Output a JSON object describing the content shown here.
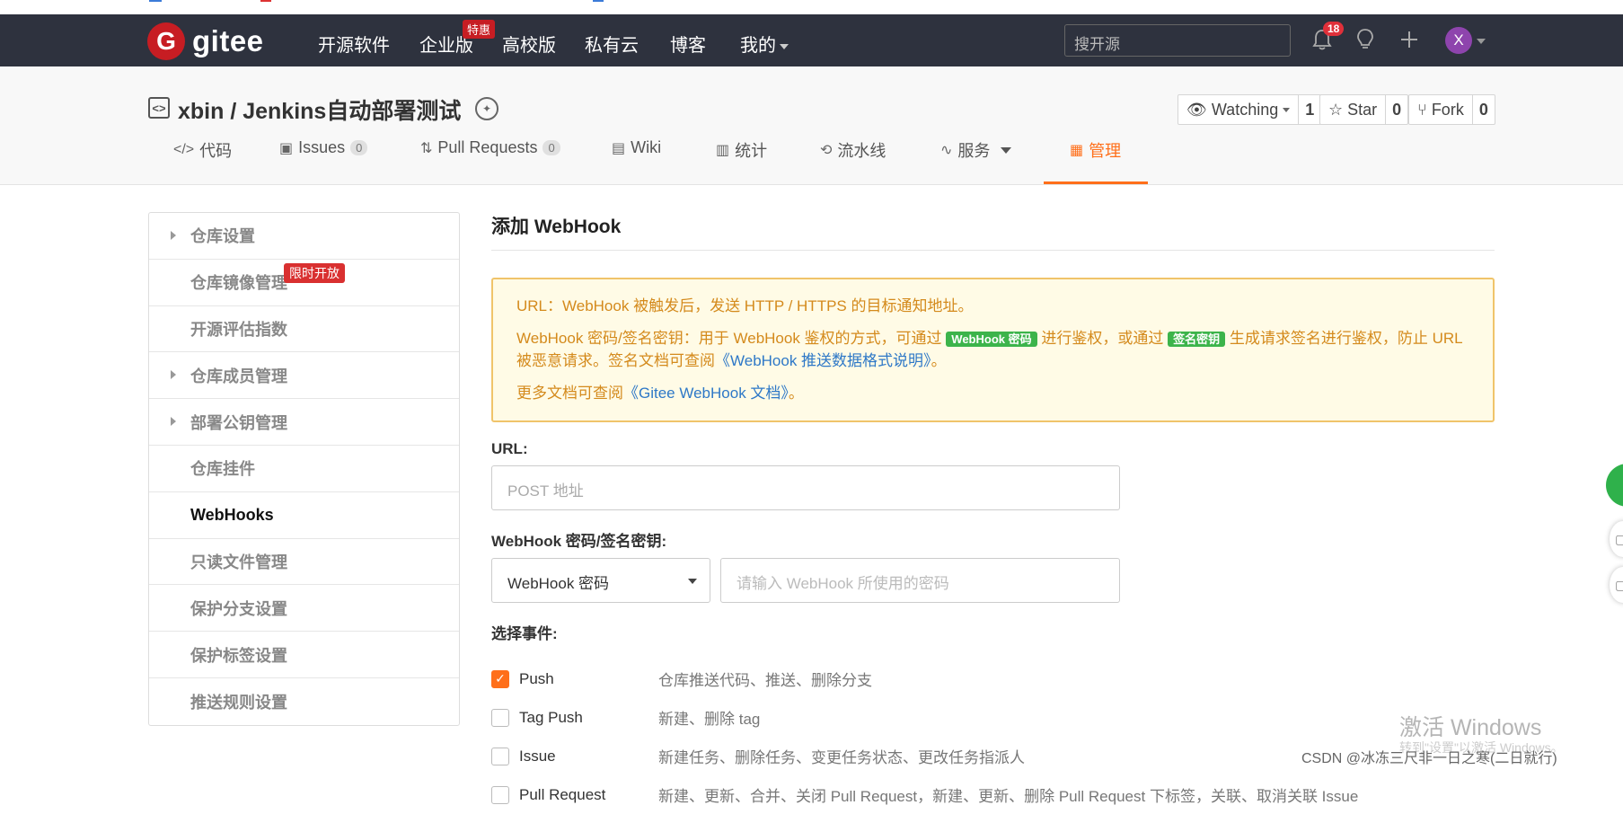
{
  "nav": {
    "logo_letter": "G",
    "logo_text": "gitee",
    "items": [
      "开源软件",
      "企业版",
      "高校版",
      "私有云",
      "博客",
      "我的"
    ],
    "hot_badge": "特惠",
    "search_placeholder": "搜开源",
    "notification_count": "18",
    "avatar_letter": "X",
    "icons": [
      "bell-icon",
      "lightbulb-icon",
      "plus-icon"
    ]
  },
  "repo": {
    "title": "xbin / Jenkins自动部署测试",
    "watch_label": "Watching",
    "watch_count": "1",
    "star_label": "Star",
    "star_count": "0",
    "fork_label": "Fork",
    "fork_count": "0"
  },
  "tabs": [
    {
      "label": "代码",
      "icon": "</>"
    },
    {
      "label": "Issues",
      "count": "0"
    },
    {
      "label": "Pull Requests",
      "count": "0"
    },
    {
      "label": "Wiki"
    },
    {
      "label": "统计"
    },
    {
      "label": "流水线"
    },
    {
      "label": "服务"
    },
    {
      "label": "管理",
      "active": true
    }
  ],
  "sidebar": {
    "items": [
      {
        "label": "仓库设置",
        "expandable": true
      },
      {
        "label": "仓库镜像管理"
      },
      {
        "label": "开源评估指数"
      },
      {
        "label": "仓库成员管理",
        "expandable": true
      },
      {
        "label": "部署公钥管理",
        "expandable": true
      },
      {
        "label": "仓库挂件"
      },
      {
        "label": "WebHooks",
        "active": true
      },
      {
        "label": "只读文件管理"
      },
      {
        "label": "保护分支设置"
      },
      {
        "label": "保护标签设置"
      },
      {
        "label": "推送规则设置"
      }
    ],
    "limited_badge": "限时开放"
  },
  "content": {
    "title": "添加 WebHook",
    "notice": {
      "line1": "URL：WebHook 被触发后，发送 HTTP / HTTPS 的目标通知地址。",
      "line2_a": "WebHook 密码/签名密钥：用于 WebHook 鉴权的方式，可通过",
      "tag_password": "WebHook 密码",
      "line2_b": "进行鉴权，或通过",
      "tag_sign": "签名密钥",
      "line2_c": "生成请求签名进行鉴权，防止 URL 被恶意请求。签名文档可查阅",
      "link_format": "《WebHook 推送数据格式说明》",
      "line2_end": "。",
      "line3_a": "更多文档可查阅",
      "link_docs": "《Gitee WebHook 文档》",
      "line3_end": "。"
    },
    "url_label": "URL:",
    "url_placeholder": "POST 地址",
    "secret_label": "WebHook 密码/签名密钥:",
    "secret_select": "WebHook 密码",
    "secret_placeholder": "请输入 WebHook 所使用的密码",
    "events_label": "选择事件:",
    "events": [
      {
        "name": "Push",
        "desc": "仓库推送代码、推送、删除分支",
        "checked": true
      },
      {
        "name": "Tag Push",
        "desc": "新建、删除 tag",
        "checked": false
      },
      {
        "name": "Issue",
        "desc": "新建任务、删除任务、变更任务状态、更改任务指派人",
        "checked": false
      },
      {
        "name": "Pull Request",
        "desc": "新建、更新、合并、关闭 Pull Request，新建、更新、删除 Pull Request 下标签，关联、取消关联 Issue",
        "checked": false
      }
    ]
  },
  "overlay": {
    "watermark": "激活 Windows",
    "watermark_sub": "转到\"设置\"以激活 Windows。",
    "csdn": "CSDN @冰冻三尺非一日之寒(二日就行)"
  }
}
